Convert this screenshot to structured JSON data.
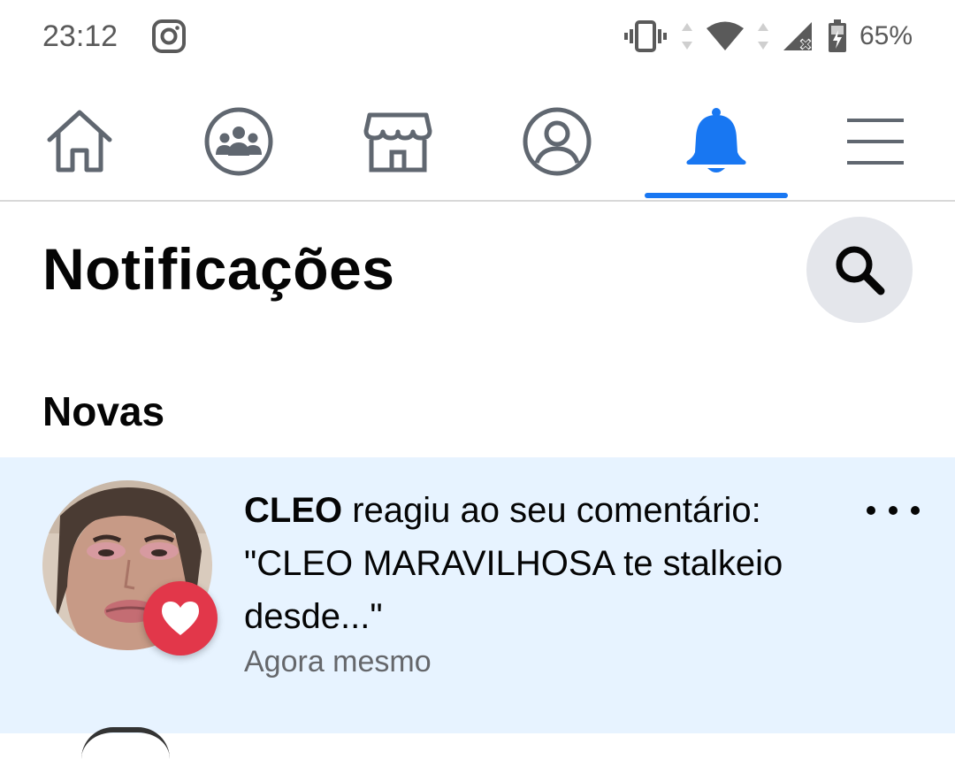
{
  "status_bar": {
    "time": "23:12",
    "notification_icon": "instagram-icon",
    "icons": [
      "vibrate-icon",
      "data-arrows-icon",
      "wifi-icon",
      "data-arrows-icon",
      "signal-icon",
      "battery-charging-icon"
    ],
    "battery_percent": "65%"
  },
  "nav": {
    "tabs": [
      {
        "id": "home",
        "icon": "home-icon",
        "active": false
      },
      {
        "id": "groups",
        "icon": "groups-icon",
        "active": false
      },
      {
        "id": "marketplace",
        "icon": "marketplace-icon",
        "active": false
      },
      {
        "id": "profile",
        "icon": "profile-icon",
        "active": false
      },
      {
        "id": "notifications",
        "icon": "bell-icon",
        "active": true
      },
      {
        "id": "menu",
        "icon": "menu-icon",
        "active": false
      }
    ],
    "accent_color": "#1877f2"
  },
  "header": {
    "title": "Notificações",
    "search_icon": "search-icon"
  },
  "sections": [
    {
      "label": "Novas",
      "items": [
        {
          "actor": "CLEO",
          "text": " reagiu ao seu comentário: \"CLEO MARAVILHOSA te stalkeio desde...\"",
          "time": "Agora mesmo",
          "reaction": "love-reaction-icon",
          "unread": true,
          "highlight_color": "#e7f3ff"
        }
      ]
    }
  ]
}
